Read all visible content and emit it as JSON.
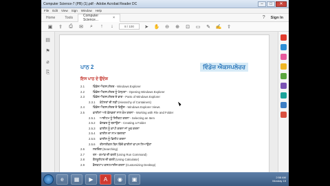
{
  "window": {
    "title": "Computer Science-7 (PB) (1).pdf - Adobe Acrobat Reader DC",
    "min": "–",
    "max": "□",
    "close": "✕"
  },
  "menu": [
    "File",
    "Edit",
    "View",
    "Sign",
    "Window",
    "Help"
  ],
  "tabs": {
    "home": "Home",
    "tools": "Tools",
    "doc": "Computer Science...",
    "doc_close": "×",
    "help": "?",
    "signin": "Sign In"
  },
  "toolbar": {
    "page": "8 / 100"
  },
  "document": {
    "chapter_num": "ਪਾਠ 2",
    "chapter_title": "ਵਿੰਡੋਜ਼ ਐਕਸਪਲੋਰਰ",
    "objectives_heading": "ਇਸ ਪਾਠ ਦੇ ਉਦੇਸ਼",
    "items": [
      {
        "n": "2.1",
        "t": "ਵਿੰਡੋਜ਼ ਐਕਸਪਲੋਰਰ - Windows Explorer",
        "lvl": 0
      },
      {
        "n": "2.2",
        "t": "ਵਿੰਡੋਜ਼ ਐਕਸਪਲੋਰਰ ਨੂੰ ਖੋਲ੍ਹਣਾ - Opening Windows Explorer",
        "lvl": 0
      },
      {
        "n": "2.3",
        "t": "ਵਿੰਡੋਜ਼ ਐਕਸਪਲੋਰਰ ਦੇ ਭਾਗ - Parts of Windows Explorer",
        "lvl": 0
      },
      {
        "n": "2.3.1",
        "t": "ਕੰਟੇਨਰਾਂ ਦੀ ਲੜੀ (Hierarchy of Containers)",
        "lvl": 1
      },
      {
        "n": "2.4",
        "t": "ਵਿੰਡੋਜ਼ ਐਕਸਪਲੋਰਰ ਦੇ ਵਿਊਜ਼ - Windows Explorer Views",
        "lvl": 0
      },
      {
        "n": "2.5",
        "t": "ਫ਼ਾਈਲਾਂ ਅਤੇ ਫ਼ੋਲਡਰਾਂ ਨਾਲ ਕੰਮ ਕਰਨਾ - Working with File and Folder",
        "lvl": 0
      },
      {
        "n": "2.5.1",
        "t": "ਆਈਟਮ ਨੂੰ ਸਿਲੈਕਟ ਕਰਨਾ - Selecting an Item",
        "lvl": 1
      },
      {
        "n": "2.5.2",
        "t": "ਫ਼ੋਲਡਰ ਨੂੰ ਬਣਾਉਣਾ - Creating a Folder",
        "lvl": 1
      },
      {
        "n": "2.5.3",
        "t": "ਫ਼ਾਈਲ ਨੂੰ ਕਾਪੀ ਕਰਨਾ ਜਾਂ ਮੂਵ ਕਰਨਾ",
        "lvl": 1
      },
      {
        "n": "2.5.4",
        "t": "ਫ਼ਾਈਲ ਦਾ ਨਾਮ ਬਦਲਣਾ",
        "lvl": 1
      },
      {
        "n": "2.5.5",
        "t": "ਫ਼ਾਈਲ ਨੂੰ ਡਿਲੀਟ ਕਰਨਾ",
        "lvl": 1
      },
      {
        "n": "2.5.6",
        "t": "ਰੀਸਾਈਕਲ ਬਿਨ ਵਿੱਚੋਂ ਫ਼ਾਈਲਾਂ ਵਾਪਸ ਲਿਆਉਣਾ",
        "lvl": 1
      },
      {
        "n": "2.6",
        "t": "ਸਰਚਿੰਗ (Searching)",
        "lvl": 0
      },
      {
        "n": "2.7",
        "t": "ਰਨ - ਕਮਾਂਡ ਦੀ ਵਰਤੋਂ (Using Run Command)",
        "lvl": 0
      },
      {
        "n": "2.8",
        "t": "ਕੈਲਕੂਲੇਟਰ ਦੀ ਵਰਤੋਂ (Using Calculator)",
        "lvl": 0
      },
      {
        "n": "2.9",
        "t": "ਡੈਸਕਟਾਪ ਕਸਟਮਾਈਜ਼ ਕਰਨਾ (Customizing Desktop)",
        "lvl": 0
      }
    ]
  },
  "taskbar": {
    "time": "2:58 AM",
    "date": "Monday 15"
  },
  "colors": {
    "accent": "#1f6fb6",
    "heading_red": "#c0281f"
  }
}
